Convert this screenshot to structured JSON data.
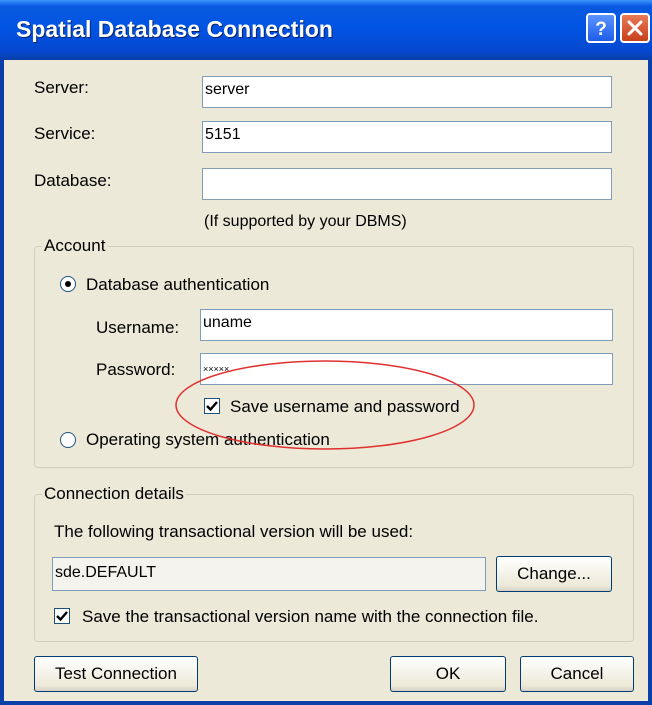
{
  "window": {
    "title": "Spatial Database Connection",
    "help_icon": "?",
    "close_icon": "✕"
  },
  "server": {
    "label": "Server:",
    "value": "server"
  },
  "service": {
    "label": "Service:",
    "value": "5151"
  },
  "database": {
    "label": "Database:",
    "value": "",
    "note": "(If supported by your DBMS)"
  },
  "account": {
    "legend": "Account",
    "db_auth_label": "Database authentication",
    "db_auth_selected": true,
    "username": {
      "label": "Username:",
      "value": "uname"
    },
    "password": {
      "label": "Password:",
      "value": "×××××"
    },
    "save_credentials": {
      "label": "Save username and password",
      "checked": true
    },
    "os_auth_label": "Operating system authentication",
    "os_auth_selected": false
  },
  "connection": {
    "legend": "Connection details",
    "intro": "The following transactional version will be used:",
    "version": "sde.DEFAULT",
    "change_label": "Change...",
    "save_version": {
      "label": "Save the transactional version name with the connection file.",
      "checked": true
    }
  },
  "buttons": {
    "test": "Test Connection",
    "ok": "OK",
    "cancel": "Cancel"
  },
  "colors": {
    "titlebar": "#0054e3",
    "dialog_bg": "#ece9d8",
    "annotation": "#e03030"
  }
}
